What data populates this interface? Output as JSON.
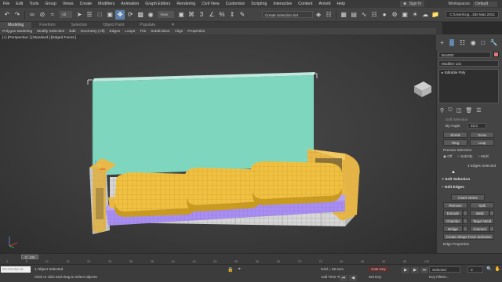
{
  "menu": {
    "items": [
      "File",
      "Edit",
      "Tools",
      "Group",
      "Views",
      "Create",
      "Modifiers",
      "Animation",
      "Graph Editors",
      "Rendering",
      "Civil View",
      "Customize",
      "Scripting",
      "Interactive",
      "Content",
      "Arnold",
      "Help"
    ],
    "signin": "Sign In",
    "workspaces_label": "Workspaces:",
    "workspace_value": "Default"
  },
  "toolbar": {
    "filter_value": "All",
    "view_value": "View",
    "selection_set_placeholder": "Create Selection Set",
    "project_path": "C:\\Users\\Ug...3ds Max 2021"
  },
  "ribbon": {
    "tabs": [
      "Modeling",
      "Freeform",
      "Selection",
      "Object Paint",
      "Populate"
    ],
    "items": [
      "Polygon Modeling",
      "Modify Selection",
      "Edit",
      "Geometry (All)",
      "Edges",
      "Loops",
      "Tris",
      "Subdivision",
      "Align",
      "Properties"
    ]
  },
  "viewport": {
    "label": "[+] [Perspective ] [Standard ] [Edged Faces ]",
    "colors": {
      "backrest": "#7fd6bf",
      "cushion": "#f0c040",
      "cushion_shadow": "#c99a20",
      "frame": "#e8b848",
      "purple_band": "#a88ef0",
      "base": "#d8d8d8",
      "gizmo_blue": "#6a8cff"
    }
  },
  "command_panel": {
    "object_name": "Box002",
    "modifier_list": "Modifier List",
    "stack_item": "Editable Poly",
    "soft_selection_partial": "Soft Selection",
    "by_angle_label": "By Angle:",
    "by_angle_value": "45.0",
    "shrink": "Shrink",
    "grow": "Grow",
    "ring": "Ring",
    "loop": "Loop",
    "preview_selection": "Preview Selection",
    "preview_options": [
      "Off",
      "SubObj",
      "Multi"
    ],
    "edges_selected": "4 Edges Selected",
    "soft_selection": "Soft Selection",
    "edit_edges": "Edit Edges",
    "insert_vertex": "Insert Vertex",
    "remove": "Remove",
    "split": "Split",
    "extrude": "Extrude",
    "weld": "Weld",
    "chamfer": "Chamfer",
    "target_weld": "Target Weld",
    "bridge": "Bridge",
    "connect": "Connect",
    "create_shape": "Create Shape From Selection",
    "edge_properties": "Edge Properties"
  },
  "timeline": {
    "frame_readout": "0 / 100",
    "ticks": [
      "0",
      "5",
      "10",
      "15",
      "20",
      "25",
      "30",
      "35",
      "40",
      "45",
      "50",
      "55",
      "60",
      "65",
      "70",
      "75",
      "80",
      "85",
      "90",
      "95",
      "100"
    ]
  },
  "status": {
    "maxscript": "MAXScript Mi",
    "selected": "1 Object Selected",
    "prompt": "Click or click-and-drag to select objects",
    "grid": "Grid = 25.4cm",
    "add_time_tag": "Add Time Tag",
    "key_mode": "Selected",
    "auto_key": "Auto Key",
    "set_key": "Set Key",
    "key_filters": "Key Filters...",
    "frame": "0"
  }
}
